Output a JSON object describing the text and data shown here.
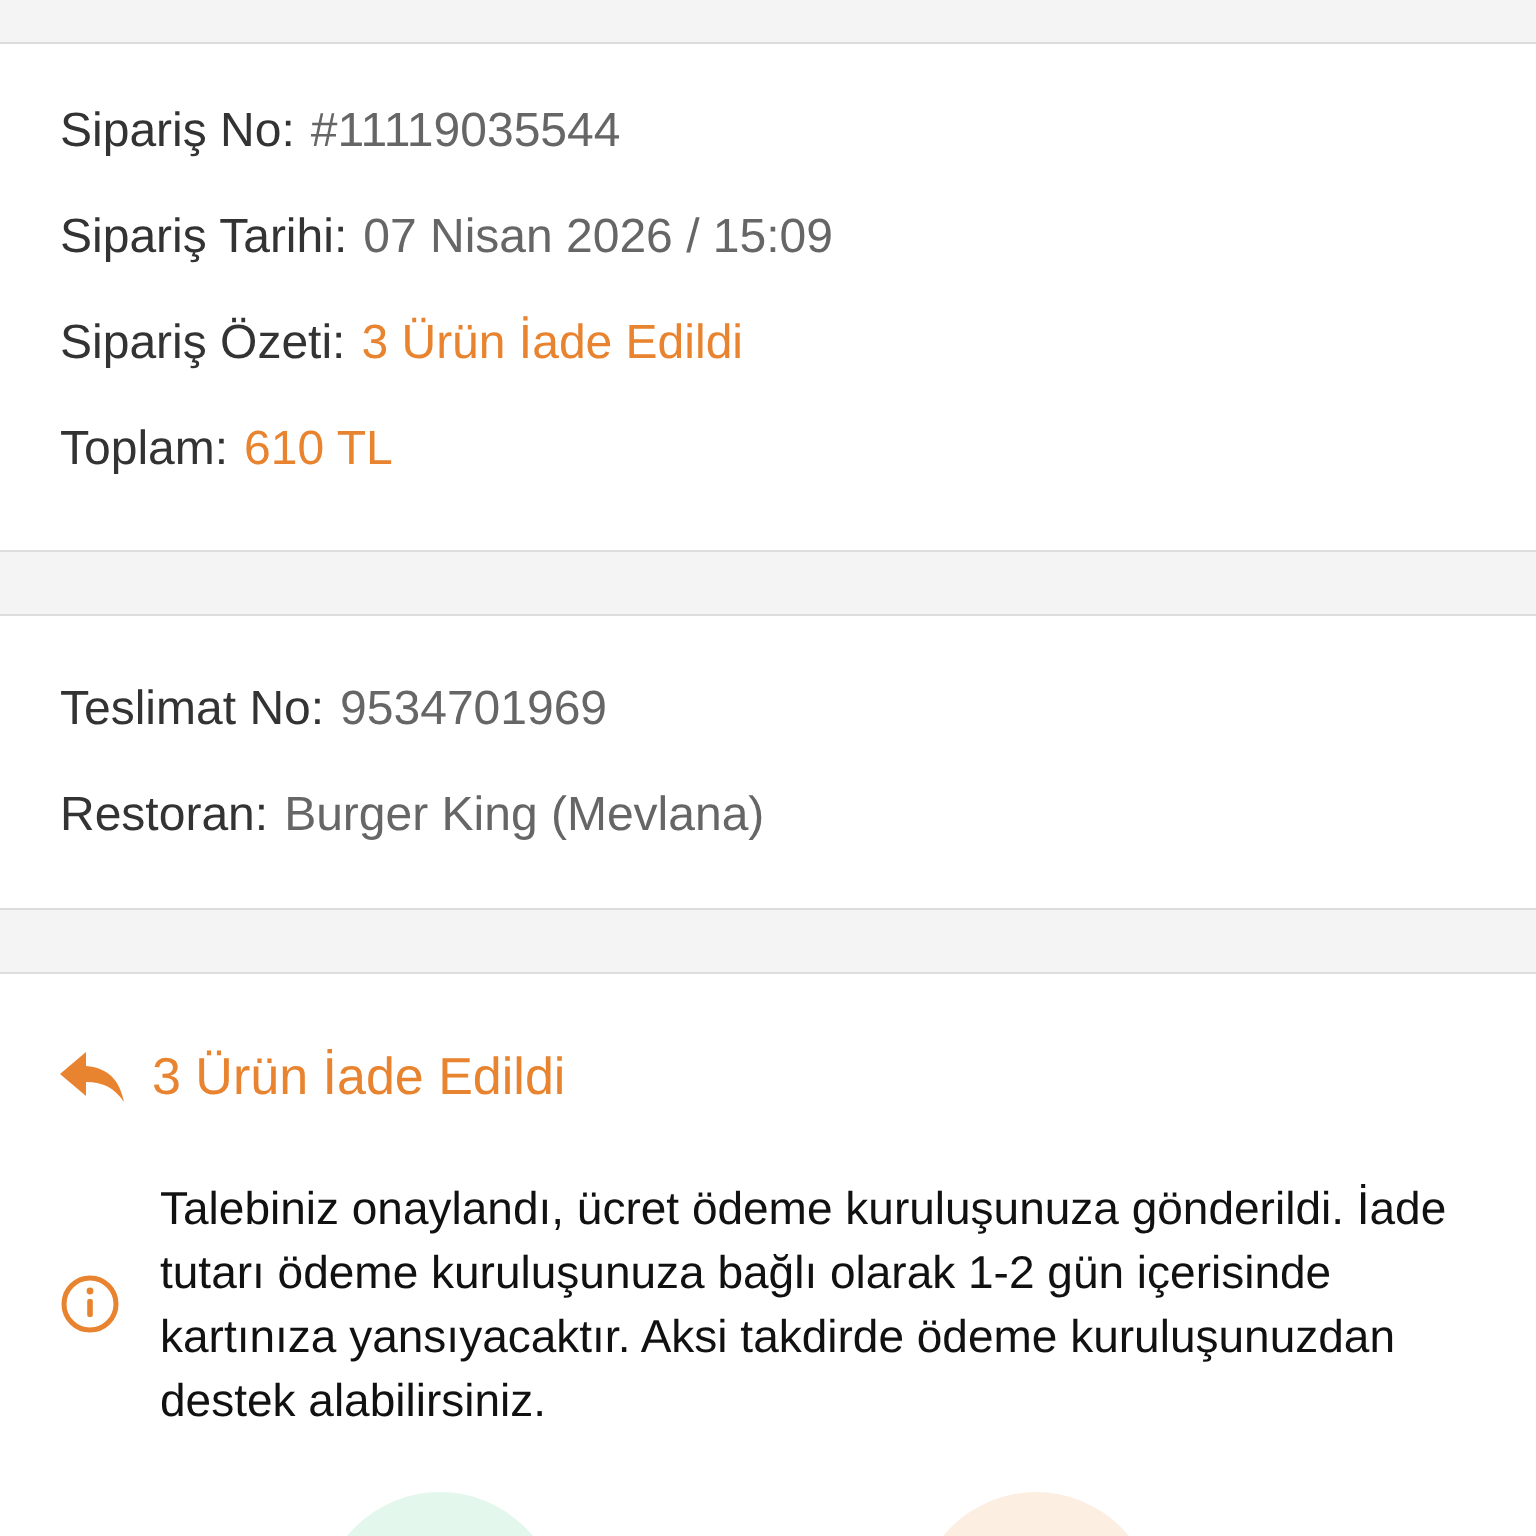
{
  "order_details": [
    {
      "label": "Sipariş No:",
      "value": "#11119035544",
      "kind": "plain"
    },
    {
      "label": "Sipariş Tarihi:",
      "value": "07 Nisan 2026 / 15:09",
      "kind": "plain"
    },
    {
      "label": "Sipariş Özeti:",
      "value": "3 Ürün İade Edildi",
      "kind": "highlight"
    },
    {
      "label": "Toplam:",
      "value": "610 TL",
      "kind": "highlight"
    }
  ],
  "delivery_details": [
    {
      "label": "Teslimat No:",
      "value": "9534701969",
      "kind": "plain"
    },
    {
      "label": "Restoran:",
      "value": "Burger King (Mevlana)",
      "kind": "plain"
    }
  ],
  "refund": {
    "title": "3 Ürün İade Edildi",
    "message": "Talebiniz onaylandı, ücret ödeme kuruluşunuza gönderildi. İade tutarı ödeme kuruluşunuza bağlı olarak 1-2 gün içerisinde kartınıza yansıyacaktır. Aksi takdirde ödeme kuruluşunuzdan destek alabilirsiniz."
  }
}
